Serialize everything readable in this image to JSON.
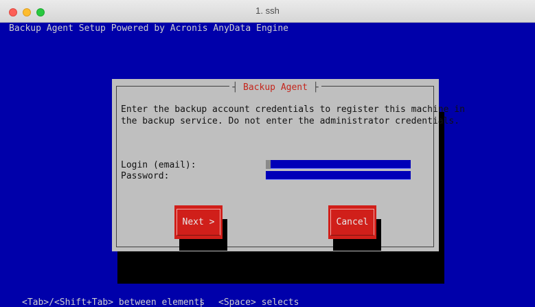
{
  "window": {
    "title": "1. ssh"
  },
  "terminal": {
    "header": "Backup Agent Setup Powered by Acronis AnyData Engine",
    "footer_tab": "<Tab>/<Shift+Tab> between elements",
    "footer_sep": "|",
    "footer_space": "<Space> selects"
  },
  "dialog": {
    "title": "Backup Agent",
    "message_line1": "Enter the backup account credentials to register this machine in",
    "message_line2": "the backup service. Do not enter the administrator credentials.",
    "login_label": "Login (email):",
    "login_value": "",
    "password_label": "Password:",
    "password_value": "",
    "next_label": "Next >",
    "cancel_label": "Cancel"
  },
  "colors": {
    "terminal_bg": "#0000aa",
    "dialog_bg": "#bfbfbf",
    "dialog_title": "#c4261c",
    "button_bg": "#d01f1a",
    "field_bg": "#0000b8"
  }
}
